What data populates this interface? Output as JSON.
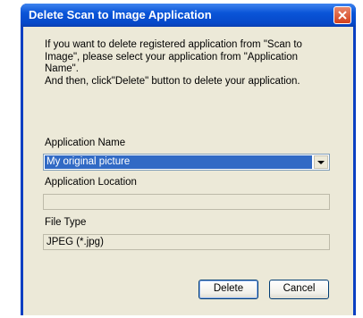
{
  "window": {
    "title": "Delete Scan to Image Application",
    "close_icon": "close-icon"
  },
  "description": [
    "If you want to delete registered application from \"Scan to",
    "Image\", please select your application from \"Application",
    "Name\".",
    "And then, click\"Delete\" button to delete your application."
  ],
  "app_name": {
    "label": "Application Name",
    "selected": "My original picture"
  },
  "app_location": {
    "label": "Application Location",
    "value": ""
  },
  "file_type": {
    "label": "File Type",
    "value": "JPEG (*.jpg)"
  },
  "buttons": {
    "delete": "Delete",
    "cancel": "Cancel"
  }
}
